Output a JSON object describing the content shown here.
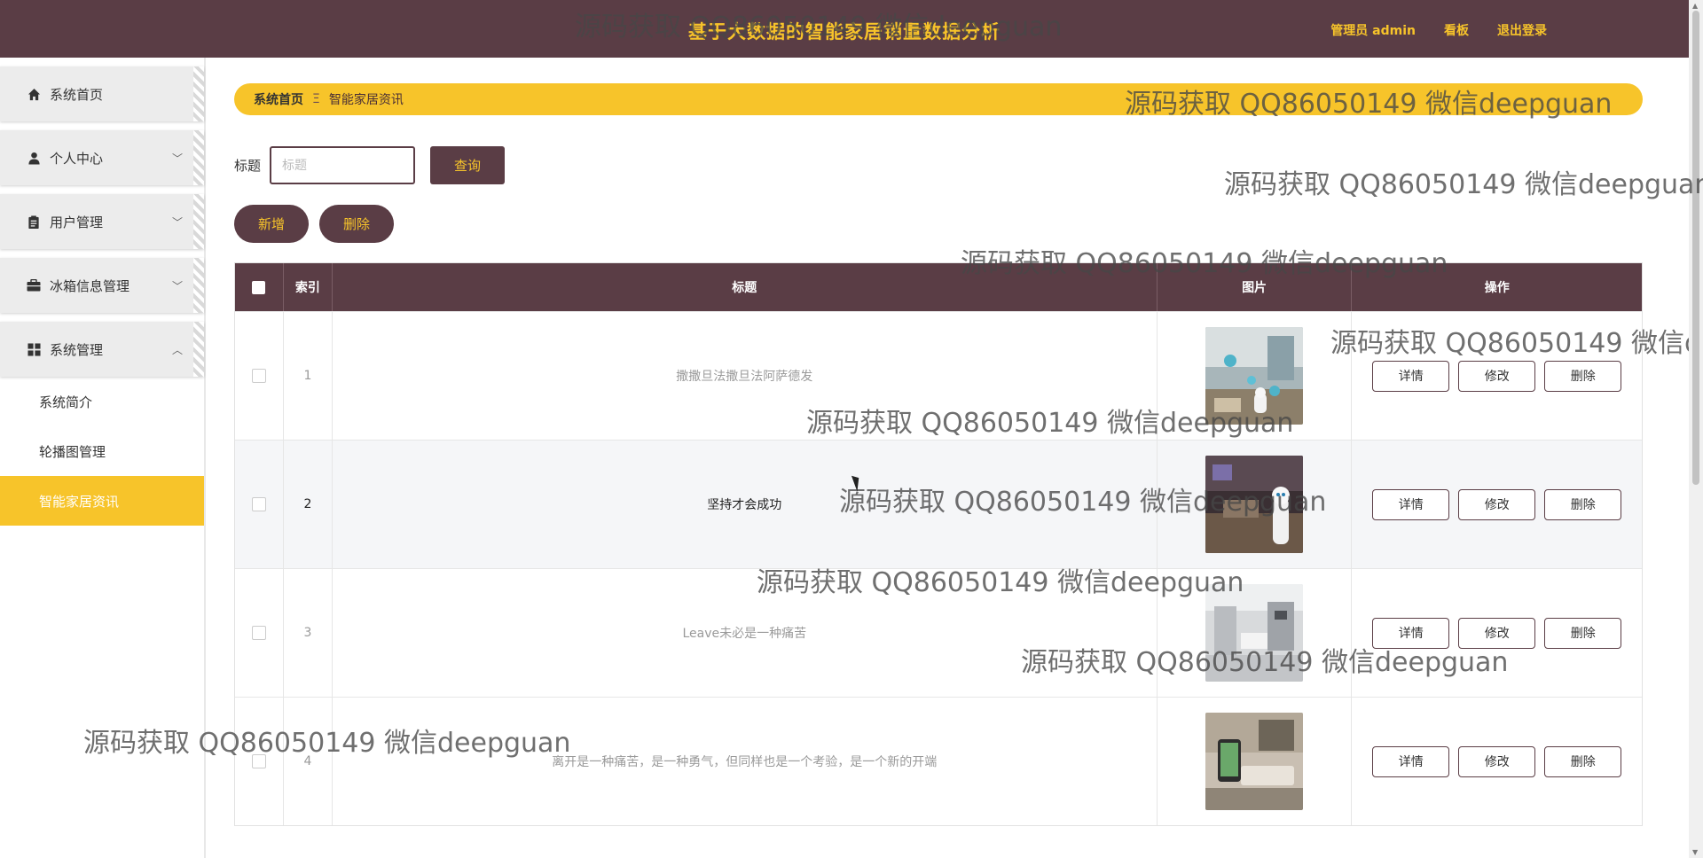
{
  "header": {
    "title": "基于大数据的智能家居销量数据分析",
    "nav": [
      "管理员 admin",
      "看板",
      "退出登录"
    ]
  },
  "sidebar": {
    "items": [
      {
        "label": "系统首页",
        "icon": "home-icon"
      },
      {
        "label": "个人中心",
        "icon": "user-icon"
      },
      {
        "label": "用户管理",
        "icon": "clipboard-icon"
      },
      {
        "label": "冰箱信息管理",
        "icon": "briefcase-icon"
      },
      {
        "label": "系统管理",
        "icon": "grid-icon"
      }
    ],
    "sub_items": [
      "系统简介",
      "轮播图管理",
      "智能家居资讯"
    ],
    "active": "智能家居资讯"
  },
  "breadcrumb": {
    "home": "系统首页",
    "separator": "Ξ",
    "current": "智能家居资讯"
  },
  "search": {
    "label": "标题",
    "placeholder": "标题",
    "button": "查询"
  },
  "actions": {
    "add": "新增",
    "delete": "删除"
  },
  "table": {
    "headers": [
      "索引",
      "标题",
      "图片",
      "操作"
    ],
    "rows": [
      {
        "index": "1",
        "title": "撒撒旦法撒旦法阿萨德发"
      },
      {
        "index": "2",
        "title": "坚持才会成功"
      },
      {
        "index": "3",
        "title": "Leave未必是一种痛苦"
      },
      {
        "index": "4",
        "title": "离开是一种痛苦，是一种勇气，但同样也是一个考验，是一个新的开端"
      }
    ],
    "ops": [
      "详情",
      "修改",
      "删除"
    ]
  },
  "watermark": "源码获取 QQ86050149 微信deepguan",
  "colors": {
    "brand_dark": "#5a3d45",
    "accent_yellow": "#f7c42a"
  }
}
